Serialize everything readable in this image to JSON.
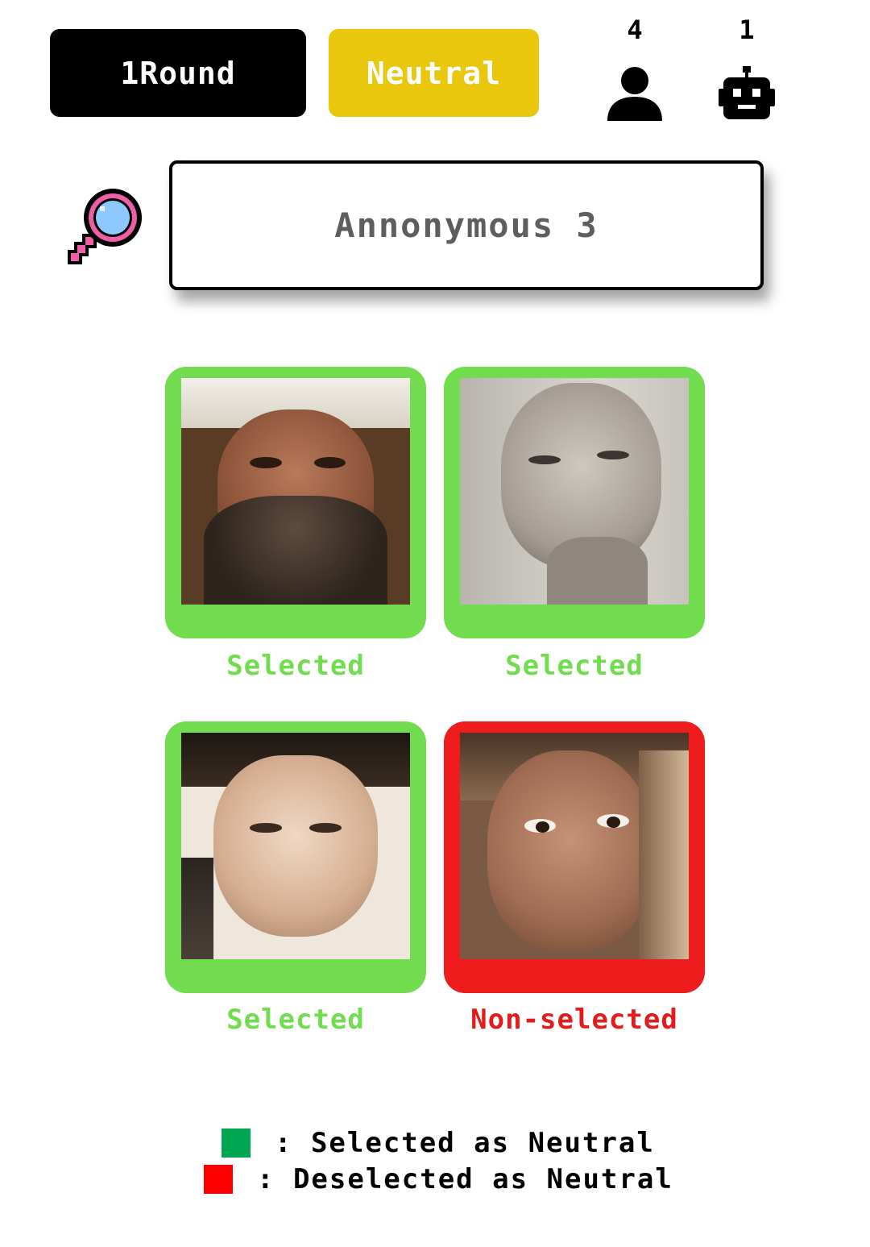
{
  "header": {
    "round_label": "1Round",
    "mode_label": "Neutral",
    "human_count": "4",
    "bot_count": "1",
    "colors": {
      "round_bg": "#000000",
      "mode_bg": "#e9c70c"
    },
    "icons": {
      "human": "person-icon",
      "bot": "robot-icon"
    }
  },
  "search": {
    "icon": "magnifier-icon",
    "value": "Annonymous 3"
  },
  "cards": [
    {
      "caption": "Selected",
      "status": "selected",
      "border_color": "#71dc4e",
      "caption_color": "#71dc4e"
    },
    {
      "caption": "Selected",
      "status": "selected",
      "border_color": "#71dc4e",
      "caption_color": "#71dc4e"
    },
    {
      "caption": "Selected",
      "status": "selected",
      "border_color": "#71dc4e",
      "caption_color": "#71dc4e"
    },
    {
      "caption": "Non-selected",
      "status": "non-selected",
      "border_color": "#ee1c1c",
      "caption_color": "#e41b1b"
    }
  ],
  "legend": {
    "items": [
      {
        "label": ": Selected as Neutral",
        "color": "#00a651"
      },
      {
        "label": ": Deselected as Neutral",
        "color": "#ff0000"
      }
    ]
  }
}
